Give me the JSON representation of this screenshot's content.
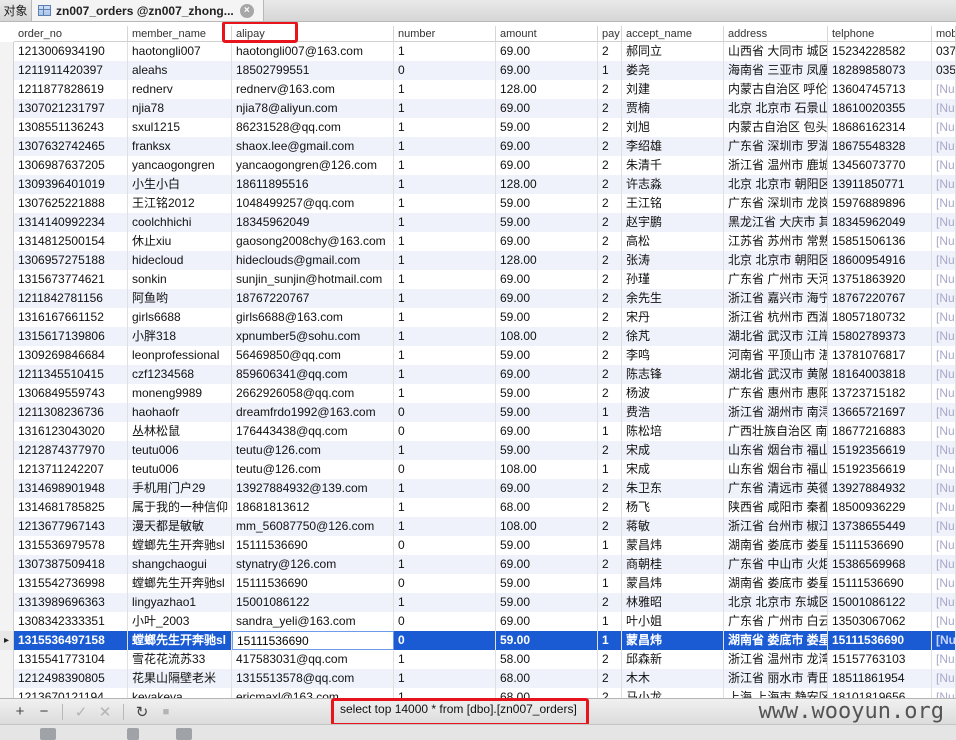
{
  "tabs": {
    "objects_label": "对象",
    "active_label": "zn007_orders @zn007_zhong...",
    "close_symbol": "×"
  },
  "ghost_row_text": "",
  "columns": [
    {
      "key": "order_no",
      "label": "order_no"
    },
    {
      "key": "member_name",
      "label": "member_name"
    },
    {
      "key": "alipay",
      "label": "alipay"
    },
    {
      "key": "number",
      "label": "number"
    },
    {
      "key": "amount",
      "label": "amount"
    },
    {
      "key": "pay",
      "label": "pay"
    },
    {
      "key": "accept_name",
      "label": "accept_name"
    },
    {
      "key": "address",
      "label": "address"
    },
    {
      "key": "telphone",
      "label": "telphone"
    },
    {
      "key": "mobile",
      "label": "mob"
    }
  ],
  "rows": [
    {
      "marker": "",
      "order_no": "121300693419​0",
      "member_name": "haotongli007",
      "alipay": "haotongli007@163.com",
      "number": "1",
      "amount": "69.00",
      "pay": "2",
      "accept_name": "郝同立",
      "address": "山西省 大同市 城区",
      "telphone": "15234228582",
      "mobile": "037"
    },
    {
      "marker": "",
      "order_no": "121191142039​7",
      "member_name": "aleahs",
      "alipay": "18502799551",
      "number": "0",
      "amount": "69.00",
      "pay": "1",
      "accept_name": "娄尧",
      "address": "海南省 三亚市 凤凰",
      "telphone": "18289858073",
      "mobile": "035"
    },
    {
      "marker": "",
      "order_no": "121187782861​9",
      "member_name": "rednerv",
      "alipay": "rednerv@163.com",
      "number": "1",
      "amount": "128.00",
      "pay": "2",
      "accept_name": "刘建",
      "address": "内蒙古自治区 呼伦",
      "telphone": "13604745713",
      "mobile": "[Nu"
    },
    {
      "marker": "",
      "order_no": "130702123179​7",
      "member_name": "njia78",
      "alipay": "njia78@aliyun.com",
      "number": "1",
      "amount": "69.00",
      "pay": "2",
      "accept_name": "贾楠",
      "address": "北京 北京市 石景山",
      "telphone": "18610020355",
      "mobile": "[Nu"
    },
    {
      "marker": "",
      "order_no": "130855113624​3",
      "member_name": "sxul1215",
      "alipay": "86231528@qq.com",
      "number": "1",
      "amount": "59.00",
      "pay": "2",
      "accept_name": "刘旭",
      "address": "内蒙古自治区 包头",
      "telphone": "18686162314",
      "mobile": "[Nu"
    },
    {
      "marker": "",
      "order_no": "130763274246​5",
      "member_name": "franksx",
      "alipay": "shaox.lee@gmail.com",
      "number": "1",
      "amount": "69.00",
      "pay": "2",
      "accept_name": "李绍雄",
      "address": "广东省 深圳市 罗湖",
      "telphone": "18675548328",
      "mobile": "[Nu"
    },
    {
      "marker": "",
      "order_no": "130698763720​5",
      "member_name": "yancaogongren",
      "alipay": "yancaogongren@126.com",
      "number": "1",
      "amount": "69.00",
      "pay": "2",
      "accept_name": "朱清千",
      "address": "浙江省 温州市 鹿城",
      "telphone": "13456073770",
      "mobile": "[Nu"
    },
    {
      "marker": "",
      "order_no": "130939640101​9",
      "member_name": "小生小白",
      "alipay": "18611895516",
      "number": "1",
      "amount": "128.00",
      "pay": "2",
      "accept_name": "许志淼",
      "address": "北京 北京市 朝阳区",
      "telphone": "13911850771",
      "mobile": "[Nu"
    },
    {
      "marker": "",
      "order_no": "130762522188​8",
      "member_name": "王江铭2012",
      "alipay": "1048499257@qq.com",
      "number": "1",
      "amount": "59.00",
      "pay": "2",
      "accept_name": "王江铭",
      "address": "广东省 深圳市 龙岗",
      "telphone": "15976889896",
      "mobile": "[Nu"
    },
    {
      "marker": "",
      "order_no": "131414099223​4",
      "member_name": "coolchhichi",
      "alipay": "18345962049",
      "number": "1",
      "amount": "59.00",
      "pay": "2",
      "accept_name": "赵宇鹏",
      "address": "黑龙江省 大庆市 其",
      "telphone": "18345962049",
      "mobile": "[Nu"
    },
    {
      "marker": "",
      "order_no": "131481250015​4",
      "member_name": "休止xiu",
      "alipay": "gaosong2008chy@163.com",
      "number": "1",
      "amount": "69.00",
      "pay": "2",
      "accept_name": "高松",
      "address": "江苏省 苏州市 常熟",
      "telphone": "15851506136",
      "mobile": "[Nu"
    },
    {
      "marker": "",
      "order_no": "130695727518​8",
      "member_name": "hidecloud",
      "alipay": "hideclouds@gmail.com",
      "number": "1",
      "amount": "128.00",
      "pay": "2",
      "accept_name": "张涛",
      "address": "北京 北京市 朝阳区",
      "telphone": "18600954916",
      "mobile": "[Nu"
    },
    {
      "marker": "",
      "order_no": "131567377462​1",
      "member_name": "sonkin",
      "alipay": "sunjin_sunjin@hotmail.com",
      "number": "1",
      "amount": "69.00",
      "pay": "2",
      "accept_name": "孙瑾",
      "address": "广东省 广州市 天河",
      "telphone": "13751863920",
      "mobile": "[Nu"
    },
    {
      "marker": "",
      "order_no": "121184278115​6",
      "member_name": "阿鱼哟",
      "alipay": "18767220767",
      "number": "1",
      "amount": "69.00",
      "pay": "2",
      "accept_name": "余先生",
      "address": "浙江省 嘉兴市 海宁",
      "telphone": "18767220767",
      "mobile": "[Nu"
    },
    {
      "marker": "",
      "order_no": "131616766115​2",
      "member_name": "girls6688",
      "alipay": "girls6688@163.com",
      "number": "1",
      "amount": "59.00",
      "pay": "2",
      "accept_name": "宋丹",
      "address": "浙江省 杭州市 西湖",
      "telphone": "18057180732",
      "mobile": "[Nu"
    },
    {
      "marker": "",
      "order_no": "131561713980​6",
      "member_name": "小胖318",
      "alipay": "xpnumber5@sohu.com",
      "number": "1",
      "amount": "108.00",
      "pay": "2",
      "accept_name": "徐芃",
      "address": "湖北省 武汉市 江岸",
      "telphone": "15802789373",
      "mobile": "[Nu"
    },
    {
      "marker": "",
      "order_no": "130926984668​4",
      "member_name": "leonprofessional",
      "alipay": "56469850@qq.com",
      "number": "1",
      "amount": "59.00",
      "pay": "2",
      "accept_name": "李鸣",
      "address": "河南省 平顶山市 湛",
      "telphone": "13781076817",
      "mobile": "[Nu"
    },
    {
      "marker": "",
      "order_no": "121134551041​5",
      "member_name": "czf1234568",
      "alipay": "859606341@qq.com",
      "number": "1",
      "amount": "69.00",
      "pay": "2",
      "accept_name": "陈志锋",
      "address": "湖北省 武汉市 黄陂",
      "telphone": "18164003818",
      "mobile": "[Nu"
    },
    {
      "marker": "",
      "order_no": "130684955974​3",
      "member_name": "moneng9989",
      "alipay": "2662926058@qq.com",
      "number": "1",
      "amount": "59.00",
      "pay": "2",
      "accept_name": "杨波",
      "address": "广东省 惠州市 惠阳",
      "telphone": "13723715182",
      "mobile": "[Nu"
    },
    {
      "marker": "",
      "order_no": "121130823673​6",
      "member_name": "haohaofr",
      "alipay": "dreamfrdo1992@163.com",
      "number": "0",
      "amount": "59.00",
      "pay": "1",
      "accept_name": "费浩",
      "address": "浙江省 湖州市 南浔",
      "telphone": "13665721697",
      "mobile": "[Nu"
    },
    {
      "marker": "",
      "order_no": "131612304302​0",
      "member_name": "丛林松鼠",
      "alipay": "176443438@qq.com",
      "number": "0",
      "amount": "69.00",
      "pay": "1",
      "accept_name": "陈松培",
      "address": "广西壮族自治区 南宁",
      "telphone": "18677216883",
      "mobile": "[Nu"
    },
    {
      "marker": "",
      "order_no": "121287437797​0",
      "member_name": "teutu006",
      "alipay": "teutu@126.com",
      "number": "1",
      "amount": "59.00",
      "pay": "2",
      "accept_name": "宋成",
      "address": "山东省 烟台市 福山",
      "telphone": "15192356619",
      "mobile": "[Nu"
    },
    {
      "marker": "",
      "order_no": "121371124220​7",
      "member_name": "teutu006",
      "alipay": "teutu@126.com",
      "number": "0",
      "amount": "108.00",
      "pay": "1",
      "accept_name": "宋成",
      "address": "山东省 烟台市 福山",
      "telphone": "15192356619",
      "mobile": "[Nu"
    },
    {
      "marker": "",
      "order_no": "131469890194​8",
      "member_name": "手机用门户29",
      "alipay": "13927884932@139.com",
      "number": "1",
      "amount": "69.00",
      "pay": "2",
      "accept_name": "朱卫东",
      "address": "广东省 清远市 英德",
      "telphone": "13927884932",
      "mobile": "[Nu"
    },
    {
      "marker": "",
      "order_no": "131468178582​5",
      "member_name": "属于我的一种信仰",
      "alipay": "18681813612",
      "number": "1",
      "amount": "68.00",
      "pay": "2",
      "accept_name": "杨飞",
      "address": "陕西省 咸阳市 秦都",
      "telphone": "18500936229",
      "mobile": "[Nu"
    },
    {
      "marker": "",
      "order_no": "121367796714​3",
      "member_name": "漫天都是敏敏",
      "alipay": "mm_56087750@126.com",
      "number": "1",
      "amount": "108.00",
      "pay": "2",
      "accept_name": "蒋敏",
      "address": "浙江省 台州市 椒江",
      "telphone": "13738655449",
      "mobile": "[Nu"
    },
    {
      "marker": "",
      "order_no": "131553697957​8",
      "member_name": "螳螂先生开奔驰sl",
      "alipay": "15111536690",
      "number": "0",
      "amount": "59.00",
      "pay": "1",
      "accept_name": "蒙昌炜",
      "address": "湖南省 娄底市 娄星",
      "telphone": "15111536690",
      "mobile": "[Nu"
    },
    {
      "marker": "",
      "order_no": "130738750941​8",
      "member_name": "shangchaogui",
      "alipay": "stynatry@126.com",
      "number": "1",
      "amount": "69.00",
      "pay": "2",
      "accept_name": "商朝桂",
      "address": "广东省 中山市 火炬",
      "telphone": "15386569968",
      "mobile": "[Nu"
    },
    {
      "marker": "",
      "order_no": "131554273699​8",
      "member_name": "螳螂先生开奔驰sl",
      "alipay": "15111536690",
      "number": "0",
      "amount": "59.00",
      "pay": "1",
      "accept_name": "蒙昌炜",
      "address": "湖南省 娄底市 娄星",
      "telphone": "15111536690",
      "mobile": "[Nu"
    },
    {
      "marker": "",
      "order_no": "131398969636​3",
      "member_name": "lingyazhao1",
      "alipay": "15001086122",
      "number": "1",
      "amount": "59.00",
      "pay": "2",
      "accept_name": "林雅昭",
      "address": "北京 北京市 东城区",
      "telphone": "15001086122",
      "mobile": "[Nu"
    },
    {
      "marker": "",
      "order_no": "130834233335​1",
      "member_name": "小叶_2003",
      "alipay": "sandra_yeli@163.com",
      "number": "0",
      "amount": "69.00",
      "pay": "1",
      "accept_name": "叶小姐",
      "address": "广东省 广州市 白云",
      "telphone": "13503067062",
      "mobile": "[Nu"
    },
    {
      "marker": "▸",
      "order_no": "131553649715​8",
      "member_name": "螳螂先生开奔驰sl",
      "alipay": "15111536690",
      "number": "0",
      "amount": "59.00",
      "pay": "1",
      "accept_name": "蒙昌炜",
      "address": "湖南省 娄底市 娄星",
      "telphone": "15111536690",
      "mobile": "[Nu",
      "selected": true
    },
    {
      "marker": "",
      "order_no": "131554177310​4",
      "member_name": "雪花花流苏33",
      "alipay": "417583031@qq.com",
      "number": "1",
      "amount": "58.00",
      "pay": "2",
      "accept_name": "邱森新",
      "address": "浙江省 温州市 龙湾",
      "telphone": "15157763103",
      "mobile": "[Nu"
    },
    {
      "marker": "",
      "order_no": "121249839080​5",
      "member_name": "花果山隔壁老米",
      "alipay": "1315513578@qq.com",
      "number": "1",
      "amount": "68.00",
      "pay": "2",
      "accept_name": "木木",
      "address": "浙江省 丽水市 青田",
      "telphone": "18511861954",
      "mobile": "[Nu"
    },
    {
      "marker": "",
      "order_no": "121367012119​4",
      "member_name": "keyakeya",
      "alipay": "ericmaxl@163.com",
      "number": "1",
      "amount": "68.00",
      "pay": "2",
      "accept_name": "马小龙",
      "address": "上海 上海市 静安区",
      "telphone": "18101819656",
      "mobile": "[Nu"
    }
  ],
  "toolbar": {
    "add": "+",
    "remove": "−",
    "apply": "✓",
    "discard": "✕",
    "refresh": "↻",
    "stop": "■",
    "sql_status": "select top 14000 * from [dbo].[zn007_orders]",
    "watermark": "www.wooyun.org"
  }
}
